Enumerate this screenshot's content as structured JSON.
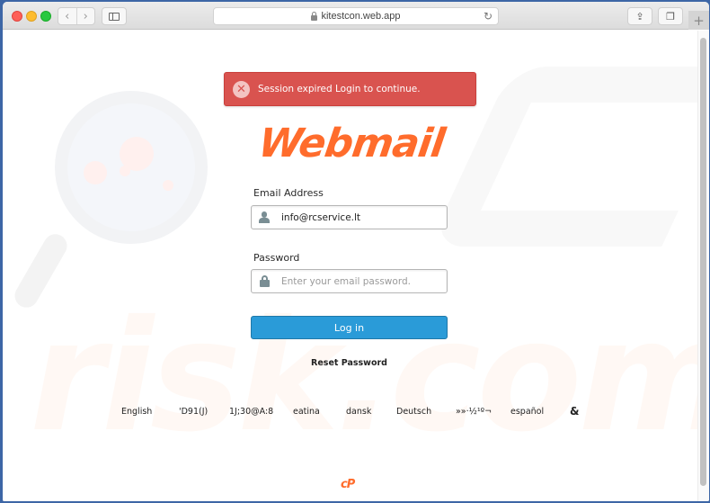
{
  "browser": {
    "url": "kitestcon.web.app",
    "back_icon": "‹",
    "forward_icon": "›",
    "reload_icon": "↻",
    "share_icon": "⇪",
    "tabs_icon": "❐",
    "new_tab_icon": "+"
  },
  "alert": {
    "icon": "✕",
    "message": "Session expired Login to continue.",
    "color": "#d9534f"
  },
  "logo": {
    "text": "Webmail",
    "color": "#ff6c2c"
  },
  "form": {
    "email_label": "Email Address",
    "email_value": "info@rcservice.lt",
    "password_label": "Password",
    "password_placeholder": "Enter your email password.",
    "login_label": "Log in",
    "reset_label": "Reset Password",
    "button_color": "#2a9bd8"
  },
  "languages": [
    "English",
    "'D91(J)",
    "1J;30@A:8",
    "eatina",
    "dansk",
    "Deutsch",
    "»»·½¹º¬",
    "español",
    "&"
  ],
  "footer": {
    "logo_text": "cP"
  },
  "watermark": {
    "text": "risk.com"
  }
}
